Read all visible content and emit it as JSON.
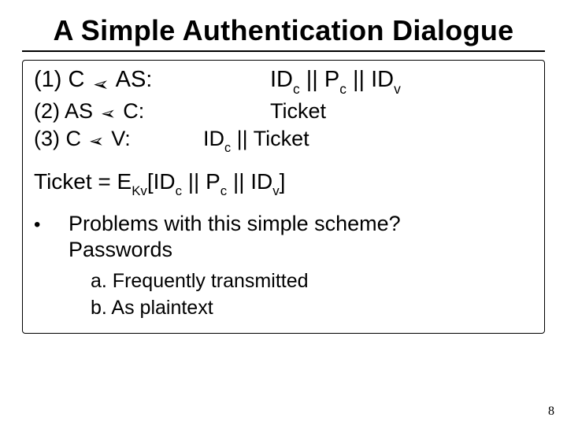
{
  "title": "A Simple Authentication Dialogue",
  "steps": {
    "one": {
      "label": "(1) C ",
      "arrow": "➣",
      "to": " AS:",
      "payload_pre": "ID",
      "payload_c": "c",
      "payload_mid1": " || P",
      "payload_cc": "c",
      "payload_mid2": " || ID",
      "payload_v": "v"
    },
    "two": {
      "label": "(2) AS ",
      "arrow": "➣",
      "to": " C:",
      "payload": "Ticket"
    },
    "three": {
      "label": "(3) C ",
      "arrow": "➣",
      "to": " V:",
      "payload_pre": "ID",
      "payload_c": "c",
      "payload_mid": " || ",
      "payload_ticket": "Ticket"
    }
  },
  "ticket": {
    "lhs": "Ticket = E",
    "kv": "Kv",
    "open": "[ID",
    "c1": "c",
    "mid1": " || P",
    "c2": "c",
    "mid2": " || ID",
    "v": "v",
    "close": "]"
  },
  "bullet": {
    "mark": "•",
    "line1": "Problems with this simple scheme?",
    "line2": "Passwords"
  },
  "sub": {
    "a": "a. Frequently transmitted",
    "b": "b. As plaintext"
  },
  "page": "8"
}
